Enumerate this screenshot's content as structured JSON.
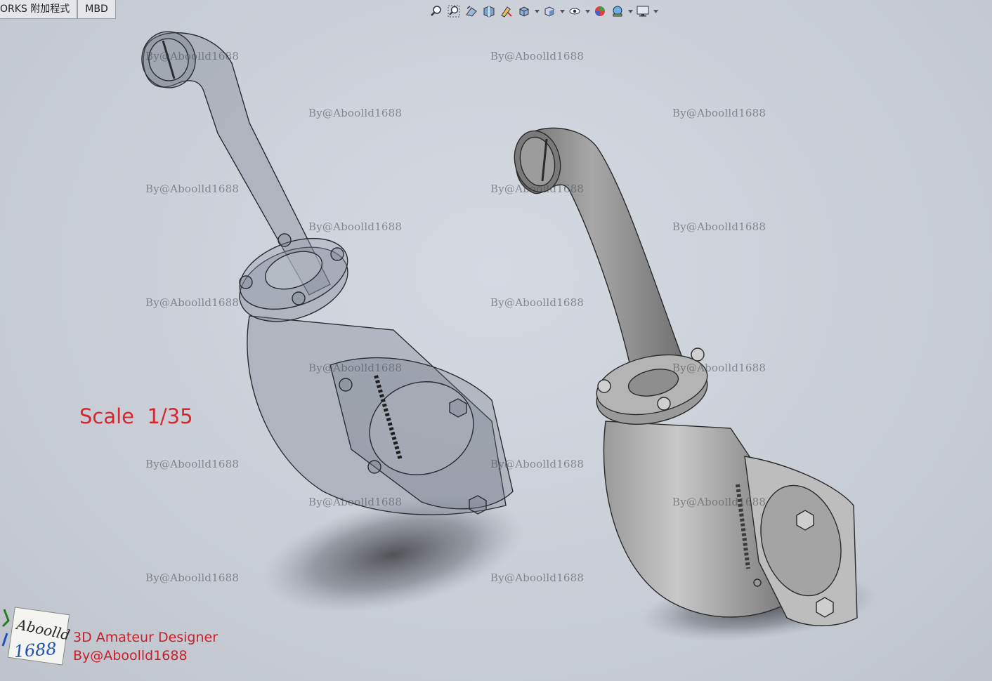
{
  "tabs": [
    {
      "label": "ORKS 附加程式"
    },
    {
      "label": "MBD"
    }
  ],
  "toolbar": {
    "items": [
      {
        "icon": "zoom-to-fit-icon",
        "dropdown": false
      },
      {
        "icon": "zoom-to-area-icon",
        "dropdown": false
      },
      {
        "icon": "previous-view-icon",
        "dropdown": false
      },
      {
        "icon": "section-view-icon",
        "dropdown": false
      },
      {
        "icon": "dynamic-annotation-icon",
        "dropdown": false
      },
      {
        "icon": "view-orientation-icon",
        "dropdown": true
      },
      {
        "icon": "display-style-icon",
        "dropdown": true
      },
      {
        "icon": "hide-show-items-icon",
        "dropdown": true
      },
      {
        "icon": "edit-appearance-icon",
        "dropdown": false
      },
      {
        "icon": "apply-scene-icon",
        "dropdown": true
      },
      {
        "icon": "view-settings-icon",
        "dropdown": true
      }
    ]
  },
  "watermark_text": "By@Aboolld1688",
  "scale_label": "Scale  1/35",
  "logo": {
    "line1": "Aboolld",
    "line2": "1688"
  },
  "credit": {
    "line1": "3D Amateur Designer",
    "line2": "By@Aboolld1688"
  },
  "colors": {
    "accent_red": "#d8262e",
    "viewport_bg": "#c9ced6"
  }
}
